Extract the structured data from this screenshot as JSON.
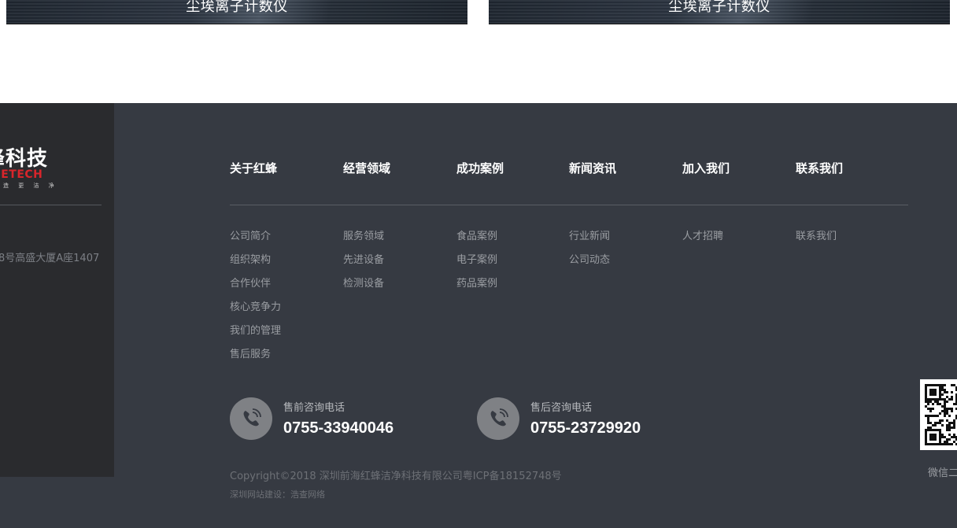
{
  "products": [
    {
      "caption": "尘埃离子计数仪"
    },
    {
      "caption": "尘埃离子计数仪"
    }
  ],
  "logo": {
    "cn": "峰科技",
    "en": "BEETECH",
    "slogan": "造 更 洁 净"
  },
  "address": "8号高盛大厦A座1407",
  "nav": [
    {
      "title": "关于红蜂",
      "links": [
        "公司简介",
        "组织架构",
        "合作伙伴",
        "核心竞争力",
        "我们的管理",
        "售后服务"
      ]
    },
    {
      "title": "经营领域",
      "links": [
        "服务领域",
        "先进设备",
        "检测设备"
      ]
    },
    {
      "title": "成功案例",
      "links": [
        "食品案例",
        "电子案例",
        "药品案例"
      ]
    },
    {
      "title": "新闻资讯",
      "links": [
        "行业新闻",
        "公司动态"
      ]
    },
    {
      "title": "加入我们",
      "links": [
        "人才招聘"
      ]
    },
    {
      "title": "联系我们",
      "links": [
        "联系我们"
      ]
    }
  ],
  "phones": {
    "presale": {
      "label": "售前咨询电话",
      "number": "0755-33940046"
    },
    "aftersale": {
      "label": "售后咨询电话",
      "number": "0755-23729920"
    }
  },
  "copyright": "Copyright©2018 深圳前海红蜂洁净科技有限公司粤ICP备18152748号",
  "builder": "深圳网站建设：浩查网络",
  "qr": {
    "label": "微信二"
  },
  "colors": {
    "footer_bg": "#363a42",
    "footer_left_bg": "#2a2b2e",
    "brand_red": "#d9252b"
  }
}
